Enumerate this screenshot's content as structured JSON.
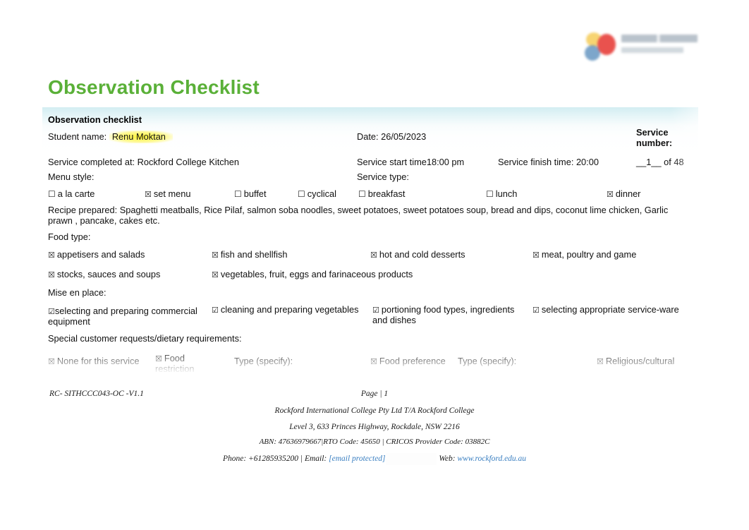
{
  "document": {
    "title": "Observation Checklist",
    "title_color": "#5ab038",
    "logo": {
      "name": "rockford-college-logo"
    }
  },
  "table": {
    "section_heading": "Observation checklist",
    "student_name_label": "Student name:",
    "student_name_value": "Renu Moktan",
    "date_label": "Date: 26/05/2023",
    "service_number_label": "Service number:",
    "service_number_value": "__1__ of 48",
    "service_completed_label": "Service completed at: Rockford College Kitchen",
    "service_start_label": "Service start time18:00 pm",
    "service_finish_label": "Service finish time: 20:00",
    "menu_style_label": "Menu style:",
    "service_type_label": "Service type:",
    "menu_style_options": [
      {
        "label": "a la carte",
        "checked": false
      },
      {
        "label": "set menu",
        "checked": true
      },
      {
        "label": "buffet",
        "checked": false
      },
      {
        "label": "cyclical",
        "checked": false
      }
    ],
    "service_type_options": [
      {
        "label": "breakfast",
        "checked": false
      },
      {
        "label": "lunch",
        "checked": false
      },
      {
        "label": "dinner",
        "checked": true
      }
    ],
    "recipe_prepared": "Recipe prepared: Spaghetti meatballs, Rice Pilaf, salmon soba noodles, sweet potatoes, sweet potatoes soup, bread and dips, coconut lime chicken, Garlic prawn , pancake, cakes  etc.",
    "food_type_label": "Food type:",
    "food_type_options": [
      {
        "label": "appetisers and salads",
        "checked": true
      },
      {
        "label": "fish and shellfish",
        "checked": true
      },
      {
        "label": "hot and cold desserts",
        "checked": true
      },
      {
        "label": "meat, poultry and game",
        "checked": true
      },
      {
        "label": "stocks, sauces and soups",
        "checked": true
      },
      {
        "label": "vegetables, fruit, eggs and farinaceous products",
        "checked": true
      }
    ],
    "mise_en_place_label": "Mise en place:",
    "mise_en_place_options": [
      {
        "label": "selecting and preparing commercial equipment",
        "checked": true
      },
      {
        "label": "cleaning and preparing vegetables",
        "checked": true
      },
      {
        "label": "portioning food types, ingredients and dishes",
        "checked": true
      },
      {
        "label": "selecting appropriate service-ware",
        "checked": true
      }
    ],
    "special_requests_label": "Special customer requests/dietary requirements:",
    "special_requests_options": [
      {
        "label": "None for this service",
        "checked": true
      },
      {
        "label": "Food restriction",
        "checked": true
      },
      {
        "label": "Type (specify):",
        "checked": null
      },
      {
        "label": "Food preference",
        "checked": true
      },
      {
        "label": "Type (specify):",
        "checked": null
      },
      {
        "label": "Religious/cultural",
        "checked": true
      }
    ]
  },
  "footer": {
    "doc_code": "RC- SITHCCC043-OC -V1.1",
    "page": "Page |  1",
    "company": "Rockford International College Pty Ltd T/A Rockford College",
    "address": "Level 3, 633 Princes Highway, Rockdale, NSW 2216",
    "registration": "ABN: 47636979667|RTO Code: 45650 |  CRICOS Provider Code: 03882C",
    "phone_label": "Phone: +61285935200 |  Email:",
    "email_value": "[email protected]",
    "web_label": "|  Web:",
    "web_value": "www.rockford.edu.au",
    "link_color": "#3a7fc1"
  },
  "glyphs": {
    "checkbox_empty": "☐",
    "checkbox_cross": "☒",
    "checkbox_tick": "☑"
  }
}
